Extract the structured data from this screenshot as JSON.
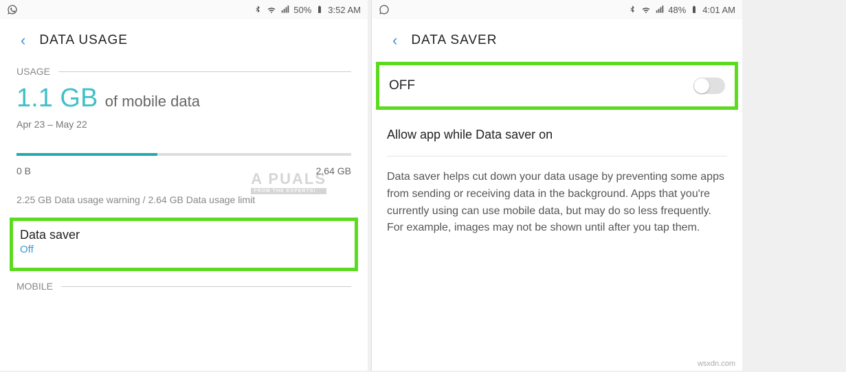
{
  "left": {
    "status": {
      "battery": "50%",
      "time": "3:52 AM"
    },
    "title": "DATA USAGE",
    "section_usage": "USAGE",
    "amount": "1.1 GB",
    "amount_caption": "of mobile data",
    "range": "Apr 23 – May 22",
    "bar_min": "0 B",
    "bar_max": "2.64 GB",
    "warning": "2.25 GB Data usage warning / 2.64 GB Data usage limit",
    "data_saver": {
      "title": "Data saver",
      "state": "Off"
    },
    "section_mobile": "MOBILE",
    "watermark": "A  PUALS",
    "watermark_sub": "FROM THE EXPERTS!"
  },
  "right": {
    "status": {
      "battery": "48%",
      "time": "4:01 AM"
    },
    "title": "DATA SAVER",
    "toggle_label": "OFF",
    "allow_app": "Allow app while Data saver on",
    "description": "Data saver helps cut down your data usage by preventing some apps from sending or receiving data in the background. Apps that you're currently using can use mobile data, but may do so less frequently. For example, images may not be shown until after you tap them."
  },
  "attribution": "wsxdn.com"
}
